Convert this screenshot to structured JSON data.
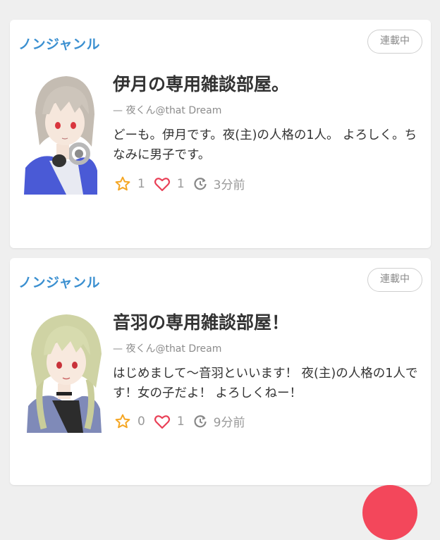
{
  "posts": [
    {
      "genre": "ノンジャンル",
      "status": "連載中",
      "title": "伊月の専用雑談部屋。",
      "author": "— 夜くん@that Dream",
      "description": "どーも。伊月です。夜(主)の人格の1人。 よろしく。ちなみに男子です。",
      "stars": "1",
      "likes": "1",
      "updated": "3分前"
    },
    {
      "genre": "ノンジャンル",
      "status": "連載中",
      "title": "音羽の専用雑談部屋！",
      "author": "— 夜くん@that Dream",
      "description": "はじめまして〜音羽といいます！ 夜(主)の人格の1人です！女の子だよ！ よろしくねー！",
      "stars": "0",
      "likes": "1",
      "updated": "9分前"
    }
  ],
  "icons": {
    "star": "star-icon",
    "heart": "heart-icon",
    "clock": "clock-icon"
  },
  "colors": {
    "genre": "#3a8fd0",
    "star": "#f5a623",
    "heart": "#e94057",
    "fab": "#f3475b"
  }
}
